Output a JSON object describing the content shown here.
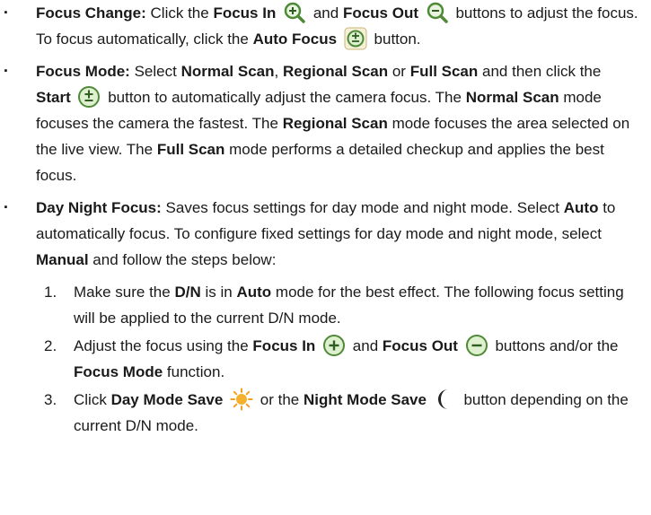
{
  "items": [
    {
      "title": "Focus Change:",
      "parts": {
        "p1": "Click the",
        "focus_in": "Focus In",
        "p2": "and",
        "focus_out": "Focus Out",
        "p3": "buttons to adjust the focus. To focus automatically, click the",
        "auto_focus": "Auto Focus",
        "p4": "button."
      },
      "icons": [
        "zoom-in-icon",
        "zoom-out-icon",
        "auto-focus-icon"
      ]
    },
    {
      "title": "Focus Mode:",
      "parts": {
        "p1": "Select",
        "normal": "Normal Scan",
        "p2": ",",
        "regional": "Regional Scan",
        "p3": "or",
        "full": "Full Scan",
        "p4": "and then click the",
        "start": "Start",
        "p5": "button to automatically adjust the camera focus. The",
        "normal2": "Normal Scan",
        "p6": "mode focuses the camera the fastest. The",
        "regional2": "Regional Scan",
        "p7": "mode focuses the area selected on the live view. The",
        "full2": "Full Scan",
        "p8": "mode performs a detailed checkup and applies the best focus."
      },
      "icons": [
        "start-icon"
      ]
    },
    {
      "title": "Day Night Focus:",
      "parts": {
        "p1": "Saves focus settings for day mode and night mode. Select",
        "auto": "Auto",
        "p2": "to automatically focus. To configure fixed settings for day mode and night mode, select",
        "manual": "Manual",
        "p3": "and follow the steps below:"
      },
      "steps": [
        {
          "num": "1.",
          "p1": "Make sure the",
          "dn": "D/N",
          "p2": "is in",
          "auto": "Auto",
          "p3": "mode for the best effect. The following focus setting will be applied to the current D/N mode."
        },
        {
          "num": "2.",
          "p1": "Adjust the focus using the",
          "focus_in": "Focus In",
          "p2": "and",
          "focus_out": "Focus Out",
          "p3": "buttons and/or the",
          "focus_mode": "Focus Mode",
          "p4": "function."
        },
        {
          "num": "3.",
          "p1": "Click",
          "day_save": "Day Mode Save",
          "p2": "or the",
          "night_save": "Night Mode Save",
          "p3": "button depending on the current D/N mode."
        }
      ]
    }
  ],
  "bullet_glyph": "▪",
  "colors": {
    "icon_green": "#6ab04c",
    "icon_dark": "#2e7d32",
    "sun": "#f0a020",
    "moon": "#222222"
  }
}
